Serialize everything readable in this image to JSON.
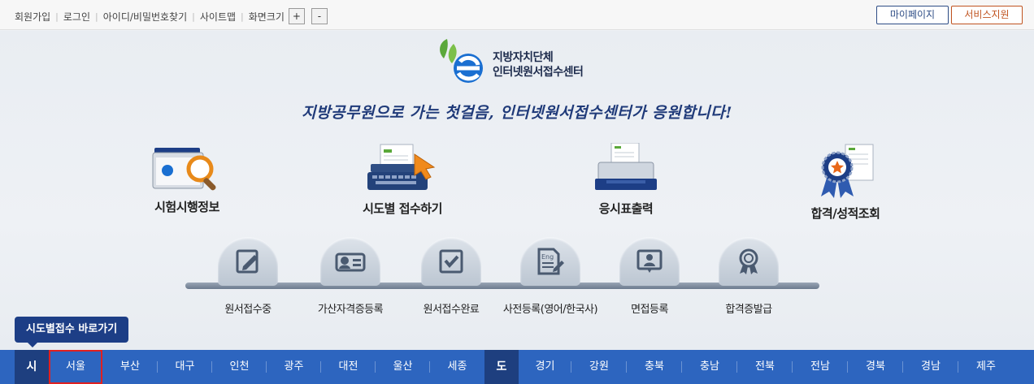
{
  "topbar": {
    "links": [
      "회원가입",
      "로그인",
      "아이디/비밀번호찾기",
      "사이트맵"
    ],
    "zoom_label": "화면크기",
    "zoom_in": "+",
    "zoom_out": "-",
    "mypage": "마이페이지",
    "support": "서비스지원"
  },
  "brand": {
    "line1": "지방자치단체",
    "line2": "인터넷원서접수센터"
  },
  "slogan": "지방공무원으로 가는 첫걸음, 인터넷원서접수센터가 응원합니다!",
  "services": [
    {
      "label": "시험시행정보",
      "icon": "folder-magnifier-icon"
    },
    {
      "label": "시도별 접수하기",
      "icon": "typewriter-cursor-icon"
    },
    {
      "label": "응시표출력",
      "icon": "printer-icon"
    },
    {
      "label": "합격/성적조회",
      "icon": "award-ribbon-icon"
    }
  ],
  "steps": [
    {
      "label": "원서접수중",
      "icon": "pencil-icon"
    },
    {
      "label": "가산자격증등록",
      "icon": "id-card-icon"
    },
    {
      "label": "원서접수완료",
      "icon": "checkbox-icon"
    },
    {
      "label": "사전등록(영어/한국사)",
      "icon": "eng-document-icon"
    },
    {
      "label": "면접등록",
      "icon": "interview-icon"
    },
    {
      "label": "합격증발급",
      "icon": "medal-icon"
    }
  ],
  "shortcut": "시도별접수 바로가기",
  "regions": {
    "si_label": "시",
    "do_label": "도",
    "si": [
      "서울",
      "부산",
      "대구",
      "인천",
      "광주",
      "대전",
      "울산",
      "세종"
    ],
    "do": [
      "경기",
      "강원",
      "충북",
      "충남",
      "전북",
      "전남",
      "경북",
      "경남",
      "제주"
    ],
    "selected": "서울"
  },
  "colors": {
    "nav": "#2d65bf",
    "nav_head": "#1e3f7f",
    "slogan": "#1f3a79",
    "mypage": "#2e4d86",
    "support": "#c0531f",
    "highlight": "#e02020"
  }
}
